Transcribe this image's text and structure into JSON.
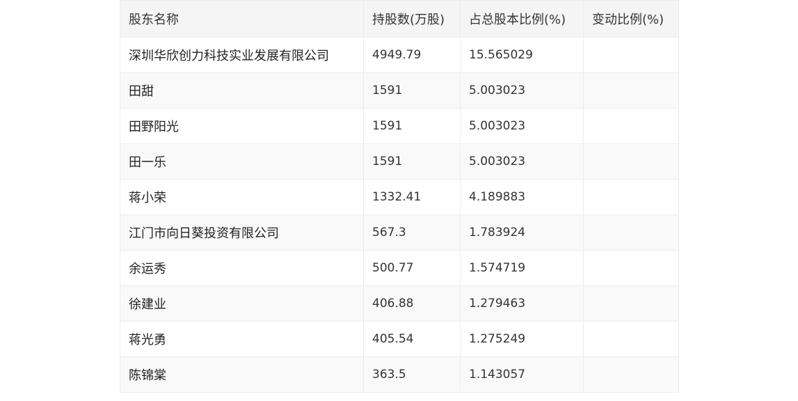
{
  "table": {
    "headers": [
      "股东名称",
      "持股数(万股)",
      "占总股本比例(%)",
      "变动比例(%)"
    ],
    "rows": [
      [
        "深圳华欣创力科技实业发展有限公司",
        "4949.79",
        "15.565029",
        ""
      ],
      [
        "田甜",
        "1591",
        "5.003023",
        ""
      ],
      [
        "田野阳光",
        "1591",
        "5.003023",
        ""
      ],
      [
        "田一乐",
        "1591",
        "5.003023",
        ""
      ],
      [
        "蒋小荣",
        "1332.41",
        "4.189883",
        ""
      ],
      [
        "江门市向日葵投资有限公司",
        "567.3",
        "1.783924",
        ""
      ],
      [
        "余运秀",
        "500.77",
        "1.574719",
        ""
      ],
      [
        "徐建业",
        "406.88",
        "1.279463",
        ""
      ],
      [
        "蒋光勇",
        "405.54",
        "1.275249",
        ""
      ],
      [
        "陈锦棠",
        "363.5",
        "1.143057",
        ""
      ]
    ]
  },
  "colors": {
    "header_bg": "#f5f5f5",
    "row_alt_bg": "#f9f9f9",
    "border": "#ececec",
    "text": "#222222"
  }
}
